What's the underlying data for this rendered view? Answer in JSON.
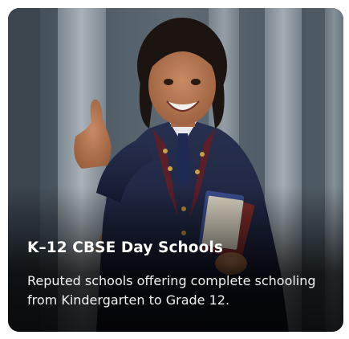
{
  "card": {
    "title": "K–12 CBSE Day Schools",
    "description": "Reputed schools offering complete schooling from Kindergarten to Grade 12.",
    "image_subject": "smiling-student-thumbs-up"
  },
  "colors": {
    "uniform": "#1c2340",
    "background": "#55616b",
    "text": "#ffffff"
  }
}
